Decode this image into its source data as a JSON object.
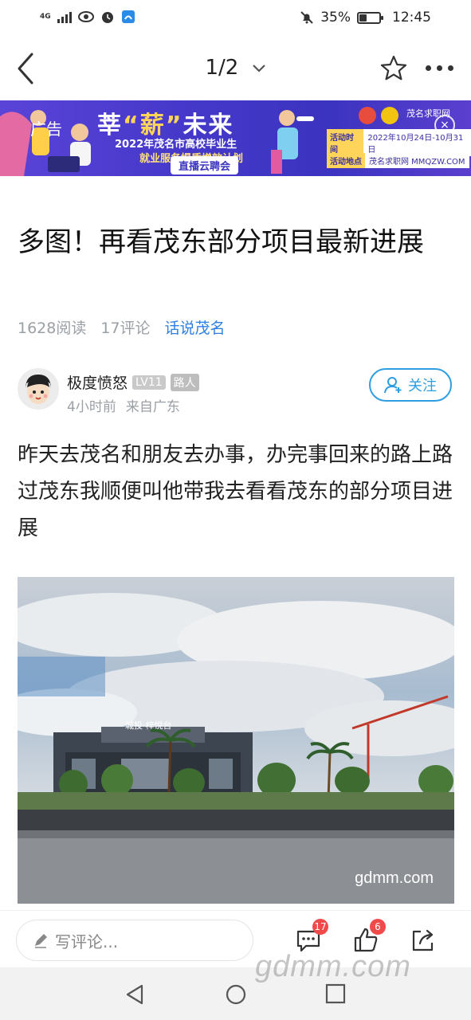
{
  "status_bar": {
    "network_small": "4G",
    "battery_percent": "35%",
    "battery_level": 0.35,
    "time": "12:45"
  },
  "topnav": {
    "page_indicator": "1/2"
  },
  "banner": {
    "ad_tag": "广告",
    "title_part1": "莘",
    "title_highlight": "“薪”",
    "title_part2": "未来",
    "subtitle1": "2022年茂名市高校毕业生",
    "subtitle2": "就业服务提质增效计划",
    "live": "直播云聘会",
    "brand": "茂名求职网",
    "time_label": "活动时间",
    "time_value": "2022年10月24日-10月31日",
    "place_label": "活动地点",
    "place_value": "茂名求职网 MMQZW.COM",
    "close": "×"
  },
  "article": {
    "title": "多图！再看茂东部分项目最新进展",
    "reads": "1628阅读",
    "comments": "17评论",
    "topic": "话说茂名",
    "author": {
      "name": "极度愤怒",
      "level": "LV11",
      "role": "路人",
      "time": "4小时前",
      "from": "来自广东",
      "follow_label": "关注"
    },
    "body": "昨天去茂名和朋友去办事，办完事回来的路上路过茂东我顺便叫他带我去看看茂东的部分项目进展",
    "photo": {
      "watermark": "gdmm.com",
      "sign_text": "城投·梓悦台"
    }
  },
  "bottom_bar": {
    "comment_placeholder": "写评论...",
    "comment_count": "17",
    "like_count": "6"
  },
  "overlay_watermark": "gdmm.com",
  "colors": {
    "accent": "#2f9ee0",
    "topic": "#2f7fe0",
    "badge_red": "#f04a4a"
  }
}
